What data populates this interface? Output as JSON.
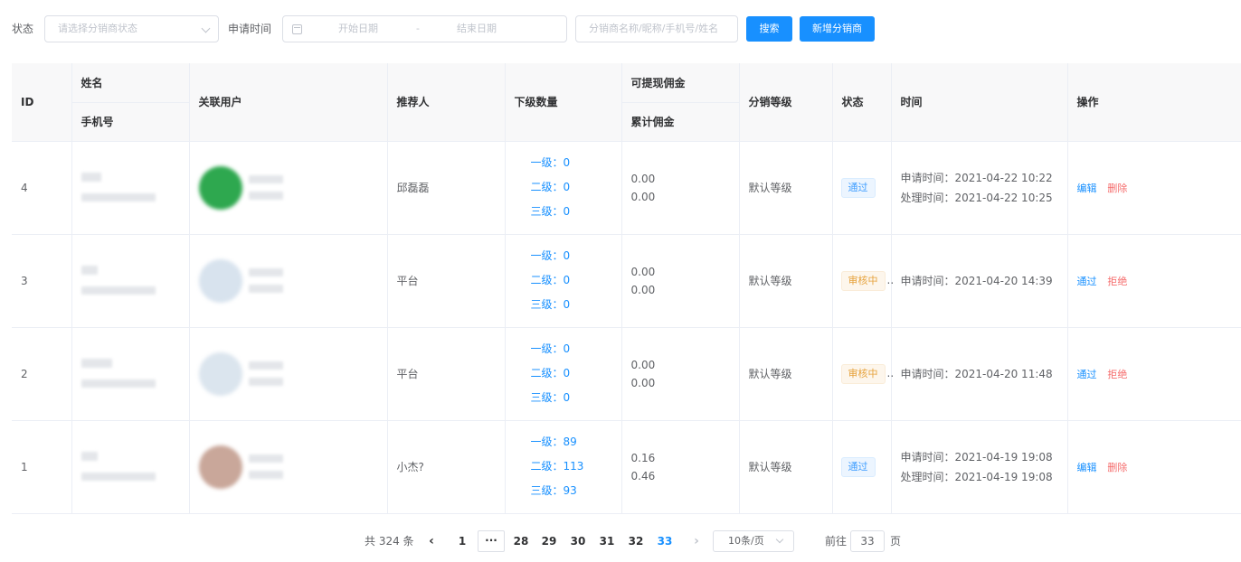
{
  "filter": {
    "status_label": "状态",
    "status_placeholder": "请选择分销商状态",
    "date_label": "申请时间",
    "start_placeholder": "开始日期",
    "date_sep": "-",
    "end_placeholder": "结束日期",
    "search_placeholder": "分销商名称/昵称/手机号/姓名",
    "search_button": "搜索",
    "add_button": "新增分销商"
  },
  "table": {
    "headers": {
      "id": "ID",
      "name": "姓名",
      "phone": "手机号",
      "linked_user": "关联用户",
      "referrer": "推荐人",
      "sub_count": "下级数量",
      "withdrawable": "可提现佣金",
      "total": "累计佣金",
      "level": "分销等级",
      "status": "状态",
      "time": "时间",
      "actions": "操作"
    },
    "rows": [
      {
        "id": "4",
        "referrer": "邱磊磊",
        "lvl1": "一级：0",
        "lvl2": "二级：0",
        "lvl3": "三级：0",
        "withdrawable": "0.00",
        "total": "0.00",
        "level": "默认等级",
        "status": "通过",
        "apply_time": "申请时间：2021-04-22 10:22",
        "process_time": "处理时间：2021-04-22 10:25",
        "op1": "编辑",
        "op2": "删除",
        "avatar_color": "#2ea84f"
      },
      {
        "id": "3",
        "referrer": "平台",
        "lvl1": "一级：0",
        "lvl2": "二级：0",
        "lvl3": "三级：0",
        "withdrawable": "0.00",
        "total": "0.00",
        "level": "默认等级",
        "status": "审核中",
        "status_suffix": "..",
        "apply_time": "申请时间：2021-04-20 14:39",
        "op1": "通过",
        "op2": "拒绝",
        "avatar_color": "#d8e3ee"
      },
      {
        "id": "2",
        "referrer": "平台",
        "lvl1": "一级：0",
        "lvl2": "二级：0",
        "lvl3": "三级：0",
        "withdrawable": "0.00",
        "total": "0.00",
        "level": "默认等级",
        "status": "审核中",
        "status_suffix": "..",
        "apply_time": "申请时间：2021-04-20 11:48",
        "op1": "通过",
        "op2": "拒绝",
        "avatar_color": "#dbe5ee"
      },
      {
        "id": "1",
        "referrer": "小杰?",
        "lvl1": "一级：89",
        "lvl2": "二级：113",
        "lvl3": "三级：93",
        "withdrawable": "0.16",
        "total": "0.46",
        "level": "默认等级",
        "status": "通过",
        "apply_time": "申请时间：2021-04-19 19:08",
        "process_time": "处理时间：2021-04-19 19:08",
        "op1": "编辑",
        "op2": "删除",
        "avatar_color": "#c9a79a"
      }
    ]
  },
  "pagination": {
    "total": "共 324 条",
    "prev": "‹",
    "first": "1",
    "more": "···",
    "pages": [
      "28",
      "29",
      "30",
      "31",
      "32",
      "33"
    ],
    "current": "33",
    "next": "›",
    "page_size": "10条/页",
    "goto_label": "前往",
    "goto_value": "33",
    "page_unit": "页"
  },
  "colors": {
    "primary": "#1890ff",
    "danger": "#f56c6c",
    "warning": "#e6a23c"
  }
}
